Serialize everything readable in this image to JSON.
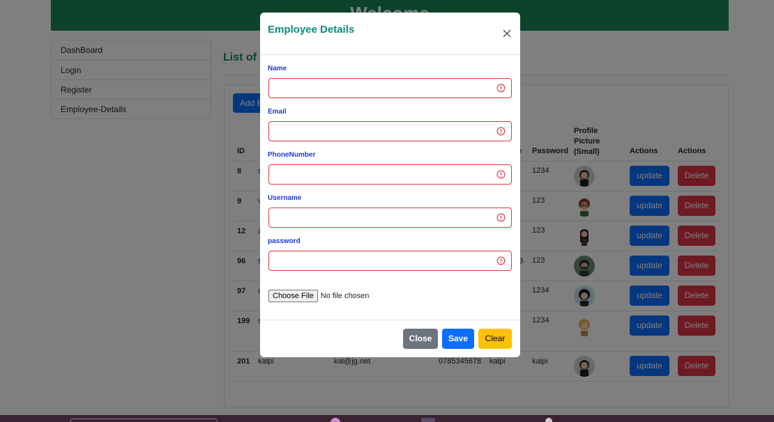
{
  "header": {
    "title": "Welcome"
  },
  "sidebar": {
    "items": [
      {
        "label": "DashBoard"
      },
      {
        "label": "Login"
      },
      {
        "label": "Register"
      },
      {
        "label": "Employee-Details"
      }
    ]
  },
  "main": {
    "heading": "List of Employees",
    "add_button": "Add Employee"
  },
  "table": {
    "headers": {
      "id": "ID",
      "password": "Password",
      "profile_picture": "Profile Picture (Small)",
      "actions1": "Actions",
      "actions2": "Actions",
      "partial_e": "e"
    },
    "rows": [
      {
        "id": "8",
        "name": "s",
        "email": "",
        "phone": "",
        "username": "",
        "password": "1234",
        "update": "update",
        "delete": "Delete"
      },
      {
        "id": "9",
        "name": "v",
        "email": "",
        "phone": "",
        "username": "",
        "password": "123",
        "update": "update",
        "delete": "Delete"
      },
      {
        "id": "12",
        "name": "a",
        "email": "",
        "phone": "",
        "username": "",
        "password": "123",
        "update": "update",
        "delete": "Delete"
      },
      {
        "id": "96",
        "name": "s",
        "email": "",
        "phone": "",
        "username": "3",
        "password": "123",
        "update": "update",
        "delete": "Delete"
      },
      {
        "id": "97",
        "name": "u",
        "email": "",
        "phone": "",
        "username": "",
        "password": "1234",
        "update": "update",
        "delete": "Delete"
      },
      {
        "id": "199",
        "name": "s",
        "email": "",
        "phone": "",
        "username": "",
        "password": "1234",
        "update": "update",
        "delete": "Delete"
      },
      {
        "id": "201",
        "name": "kalpi",
        "email": "kal@jg.net",
        "phone": "0785345678",
        "username": "kalpi",
        "password": "kalpi",
        "update": "update",
        "delete": "Delete"
      }
    ]
  },
  "modal": {
    "title": "Employee Details",
    "fields": [
      {
        "label": "Name",
        "value": ""
      },
      {
        "label": "Email",
        "value": ""
      },
      {
        "label": "PhoneNumber",
        "value": ""
      },
      {
        "label": "Username",
        "value": ""
      },
      {
        "label": "password",
        "value": ""
      }
    ],
    "file": {
      "button": "Choose File",
      "status": "No file chosen"
    },
    "buttons": {
      "close": "Close",
      "save": "Save",
      "clear": "Clear"
    }
  },
  "colors": {
    "header_bg": "#198754",
    "modal_title": "#0e8a7e",
    "field_label": "#1e3ad6",
    "invalid_border": "#dc3545",
    "primary": "#0d6efd",
    "danger": "#dc3545",
    "secondary": "#6c757d",
    "warning": "#ffc107"
  }
}
